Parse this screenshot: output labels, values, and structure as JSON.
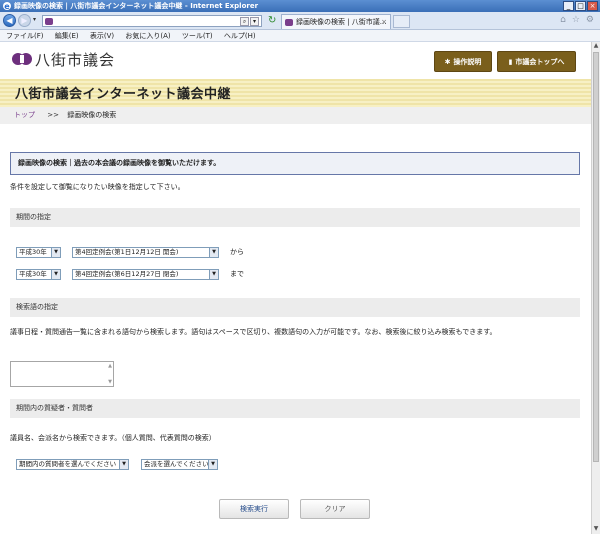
{
  "browser": {
    "window_title": "録画映像の検索 | 八街市議会インターネット議会中継 - Internet Explorer",
    "tab_title": "録画映像の検索 | 八街市議...",
    "window_buttons": [
      "_",
      "□",
      "×"
    ],
    "menu": [
      "ファイル(F)",
      "編集(E)",
      "表示(V)",
      "お気に入り(A)",
      "ツール(T)",
      "ヘルプ(H)"
    ]
  },
  "header": {
    "logo_text": "八街市議会",
    "help_button": "操作説明",
    "top_button": "市議会トップへ",
    "brand_color": "#7a5f1c"
  },
  "banner": {
    "title": "八街市議会インターネット議会中継"
  },
  "breadcrumb": {
    "home": "トップ",
    "separator": ">>",
    "current": "録画映像の検索"
  },
  "notice": {
    "text": "録画映像の検索｜過去の本会議の録画映像を御覧いただけます。"
  },
  "intro": "条件を設定して御覧になりたい映像を指定して下さい。",
  "period": {
    "heading": "期間の指定",
    "from": {
      "era": "平成30年",
      "session": "第4回定例会(第1日12月12日 開会)",
      "suffix": "から"
    },
    "to": {
      "era": "平成30年",
      "session": "第4回定例会(第6日12月27日 閉会)",
      "suffix": "まで"
    }
  },
  "keyword": {
    "heading": "検索語の指定",
    "description": "議事日程・質問通告一覧に含まれる語句から検索します。語句はスペースで区切り、複数語句の入力が可能です。なお、検索後に絞り込み検索もできます。"
  },
  "person": {
    "heading": "期間内の質疑者・質問者",
    "description": "議員名、会派名から検索できます。（個人質問、代表質問の検索）",
    "person_select": "期間内の質問者を選んでください",
    "group_select": "会派を選んでください"
  },
  "actions": {
    "search": "検索実行",
    "clear": "クリア"
  }
}
